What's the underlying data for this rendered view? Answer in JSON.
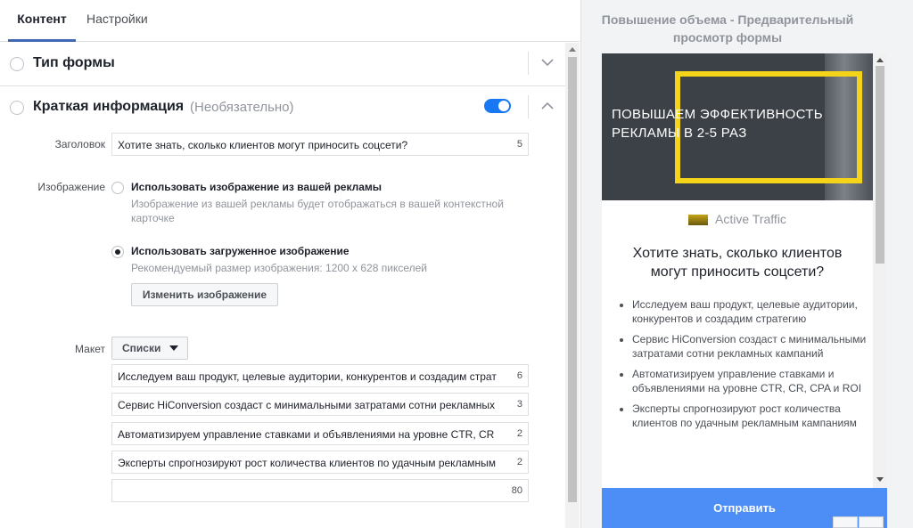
{
  "tabs": {
    "content": "Контент",
    "settings": "Настройки"
  },
  "sections": {
    "form_type": {
      "title": "Тип формы"
    },
    "brief": {
      "title": "Краткая информация",
      "optional": "(Необязательно)",
      "enabled": true
    }
  },
  "brief": {
    "headline_label": "Заголовок",
    "headline_value": "Хотите знать, сколько клиентов могут приносить соцсети?",
    "headline_count": "5",
    "image_label": "Изображение",
    "image_options": [
      {
        "title": "Использовать изображение из вашей рекламы",
        "desc": "Изображение из вашей рекламы будет отображаться в вашей контекстной карточке",
        "selected": false
      },
      {
        "title": "Использовать загруженное изображение",
        "desc": "Рекомендуемый размер изображения: 1200 x 628 пикселей",
        "selected": true
      }
    ],
    "change_image_button": "Изменить изображение",
    "layout_label": "Макет",
    "layout_value": "Списки",
    "list_items": [
      {
        "value": "Исследуем ваш продукт, целевые аудитории, конкурентов и создадим страт",
        "count": "6"
      },
      {
        "value": "Сервис HiConversion создаст с минимальными затратами сотни рекламных",
        "count": "3"
      },
      {
        "value": "Автоматизируем управление ставками и объявлениями на уровне CTR, CR",
        "count": "2"
      },
      {
        "value": "Эксперты спрогнозируют рост количества клиентов по удачным рекламным",
        "count": "2"
      },
      {
        "value": "",
        "count": "80"
      }
    ]
  },
  "preview": {
    "title": "Повышение объема - Предварительный просмотр формы",
    "hero_text": "ПОВЫШАЕМ ЭФФЕКТИВНОСТЬ РЕКЛАМЫ В 2-5 РАЗ",
    "brand": "Active Traffic",
    "headline": "Хотите знать, сколько клиентов могут приносить соцсети?",
    "bullets": [
      "Исследуем ваш продукт, целевые аудитории, конкурентов и создадим стратегию",
      "Сервис HiConversion создаст с минимальными затратами сотни рекламных кампаний",
      "Автоматизируем управление ставками и объявлениями на уровне CTR, CR, CPA и ROI",
      "Эксперты спрогнозируют рост количества клиентов по удачным рекламным кампаниям"
    ],
    "submit_button": "Отправить"
  },
  "colors": {
    "accent": "#4267b2",
    "toggle_on": "#1877f2",
    "submit": "#4c8df6",
    "hero_frame": "#f3d41b"
  }
}
